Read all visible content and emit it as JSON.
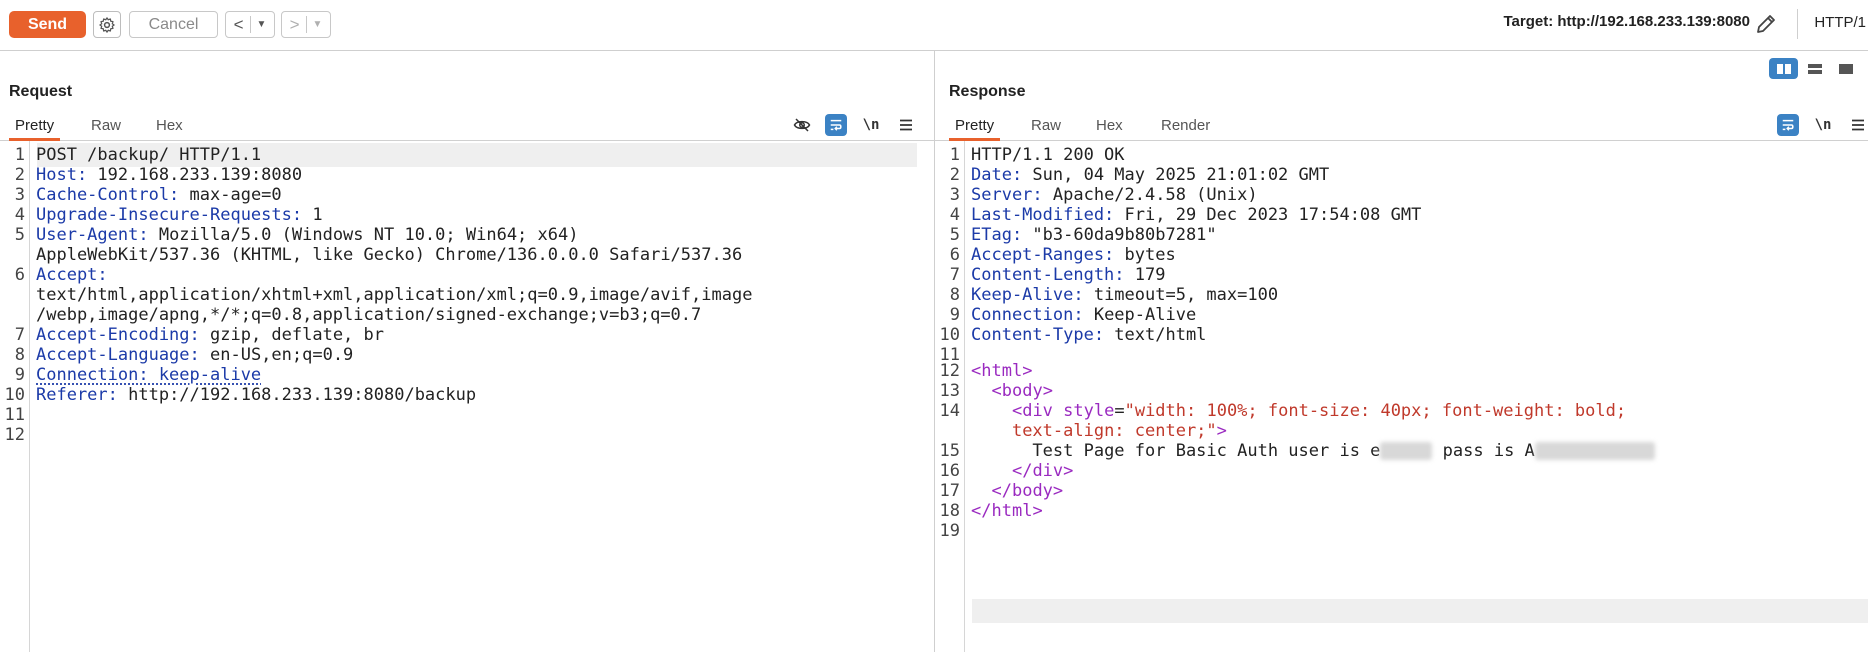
{
  "toolbar": {
    "send_label": "Send",
    "cancel_label": "Cancel",
    "target_text": "Target: http://192.168.233.139:8080",
    "http_version": "HTTP/1",
    "send_color": "#e8612c"
  },
  "icons": {
    "settings": "gear-icon",
    "back": "chevron-left-icon",
    "forward": "chevron-right-icon",
    "edit": "pencil-icon",
    "hide": "eye-off-icon",
    "wrap": "word-wrap-icon",
    "newline": "\\n",
    "menu": "hamburger-icon"
  },
  "request": {
    "title": "Request",
    "tabs": [
      "Pretty",
      "Raw",
      "Hex"
    ],
    "active_tab": "Pretty",
    "lines": [
      {
        "n": "1",
        "name": "POST /backup/ HTTP/1.1",
        "value": ""
      },
      {
        "n": "2",
        "name": "Host:",
        "value": " 192.168.233.139:8080"
      },
      {
        "n": "3",
        "name": "Cache-Control:",
        "value": " max-age=0"
      },
      {
        "n": "4",
        "name": "Upgrade-Insecure-Requests:",
        "value": " 1"
      },
      {
        "n": "5",
        "name": "User-Agent:",
        "value": " Mozilla/5.0 (Windows NT 10.0; Win64; x64)"
      },
      {
        "n": "",
        "name": "",
        "value": "AppleWebKit/537.36 (KHTML, like Gecko) Chrome/136.0.0.0 Safari/537.36"
      },
      {
        "n": "6",
        "name": "Accept:",
        "value": ""
      },
      {
        "n": "",
        "name": "",
        "value": "text/html,application/xhtml+xml,application/xml;q=0.9,image/avif,image"
      },
      {
        "n": "",
        "name": "",
        "value": "/webp,image/apng,*/*;q=0.8,application/signed-exchange;v=b3;q=0.7"
      },
      {
        "n": "7",
        "name": "Accept-Encoding:",
        "value": " gzip, deflate, br"
      },
      {
        "n": "8",
        "name": "Accept-Language:",
        "value": " en-US,en;q=0.9"
      },
      {
        "n": "9",
        "name": "Connection: keep-alive",
        "value": ""
      },
      {
        "n": "10",
        "name": "Referer:",
        "value": " http://192.168.233.139:8080/backup"
      },
      {
        "n": "11",
        "name": "",
        "value": ""
      },
      {
        "n": "12",
        "name": "",
        "value": ""
      }
    ]
  },
  "response": {
    "title": "Response",
    "tabs": [
      "Pretty",
      "Raw",
      "Hex",
      "Render"
    ],
    "active_tab": "Pretty",
    "lines": [
      {
        "n": "1",
        "name": "HTTP/1.1 200 OK",
        "value": ""
      },
      {
        "n": "2",
        "name": "Date:",
        "value": " Sun, 04 May 2025 21:01:02 GMT"
      },
      {
        "n": "3",
        "name": "Server:",
        "value": " Apache/2.4.58 (Unix)"
      },
      {
        "n": "4",
        "name": "Last-Modified:",
        "value": " Fri, 29 Dec 2023 17:54:08 GMT"
      },
      {
        "n": "5",
        "name": "ETag:",
        "value": " \"b3-60da9b80b7281\""
      },
      {
        "n": "6",
        "name": "Accept-Ranges:",
        "value": " bytes"
      },
      {
        "n": "7",
        "name": "Content-Length:",
        "value": " 179"
      },
      {
        "n": "8",
        "name": "Keep-Alive:",
        "value": " timeout=5, max=100"
      },
      {
        "n": "9",
        "name": "Connection:",
        "value": " Keep-Alive"
      },
      {
        "n": "10",
        "name": "Content-Type:",
        "value": " text/html"
      },
      {
        "n": "11",
        "name": "",
        "value": ""
      }
    ],
    "html_lines": {
      "l12": {
        "n": "12",
        "open": "<",
        "tag": "html",
        "close": ">"
      },
      "l13": {
        "n": "13",
        "indent": "  ",
        "open": "<",
        "tag": "body",
        "close": ">"
      },
      "l14": {
        "n": "14",
        "indent": "    ",
        "open": "<",
        "tag": "div",
        "attr": " style",
        "eq": "=",
        "str": "\"width: 100%; font-size: 40px; font-weight: bold;"
      },
      "l14b": {
        "indent": "    ",
        "str": "text-align: center;\"",
        "close": ">"
      },
      "l15": {
        "n": "15",
        "indent": "      ",
        "text_a": "Test Page for Basic Auth user is e",
        "text_b": " pass is A"
      },
      "l16": {
        "n": "16",
        "indent": "    ",
        "open": "</",
        "tag": "div",
        "close": ">"
      },
      "l17": {
        "n": "17",
        "indent": "  ",
        "open": "</",
        "tag": "body",
        "close": ">"
      },
      "l18": {
        "n": "18",
        "open": "</",
        "tag": "html",
        "close": ">"
      },
      "l19": {
        "n": "19"
      }
    }
  }
}
